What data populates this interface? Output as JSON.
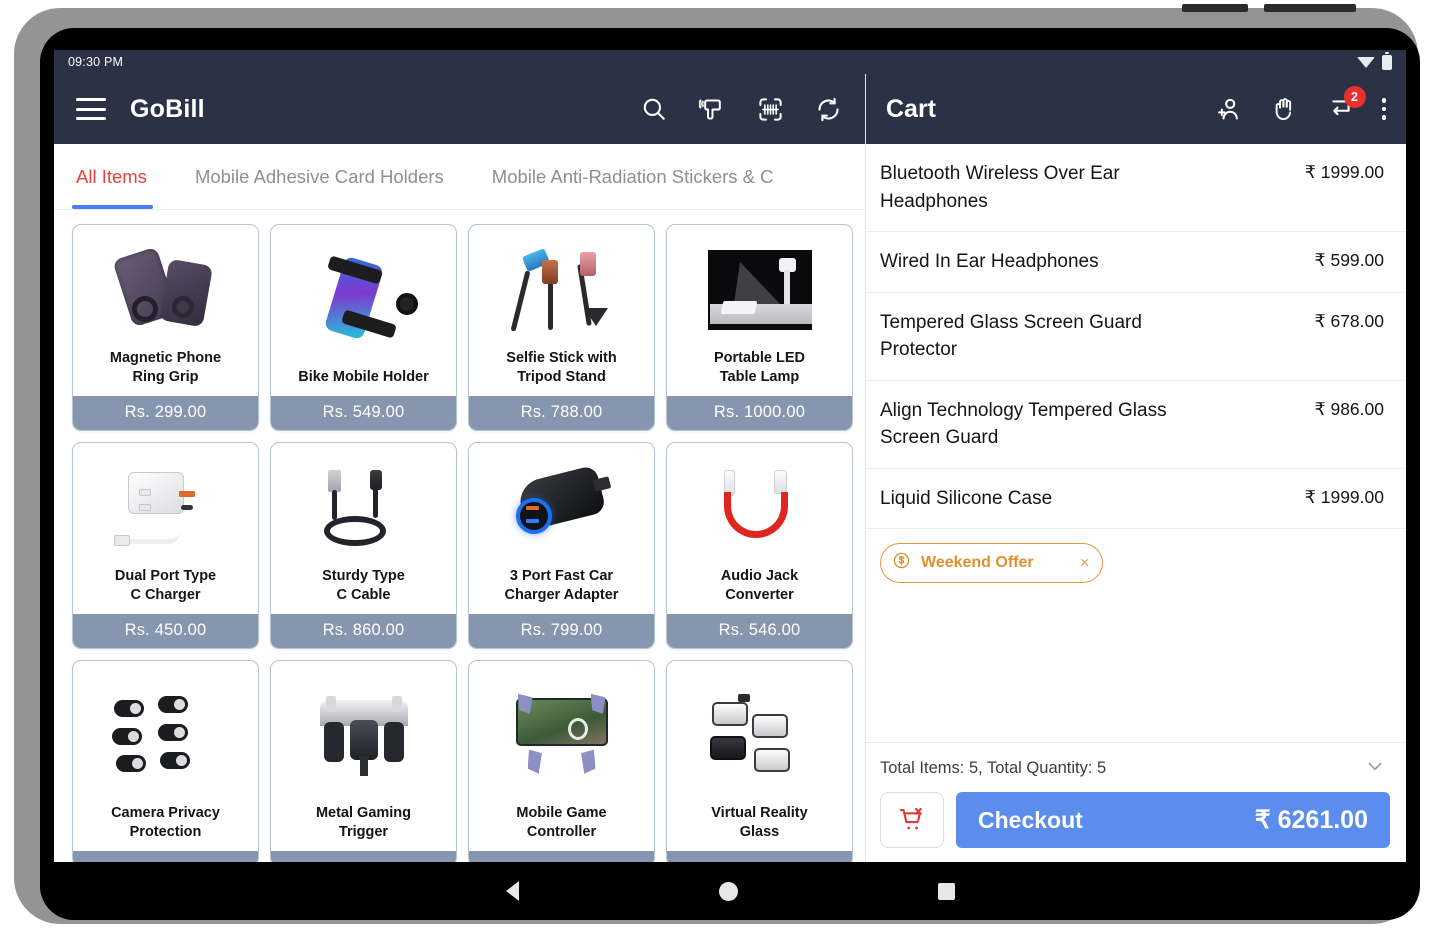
{
  "status_bar": {
    "time": "09:30 PM",
    "wifi_icon": "wifi-icon",
    "battery_icon": "battery-icon"
  },
  "app_bar": {
    "menu_icon": "hamburger-menu-icon",
    "title": "GoBill",
    "actions": [
      {
        "icon": "search-icon"
      },
      {
        "icon": "barcode-scanner-gun-icon"
      },
      {
        "icon": "barcode-scan-icon"
      },
      {
        "icon": "refresh-sync-icon"
      }
    ]
  },
  "tabs": [
    {
      "label": "All Items",
      "active": true
    },
    {
      "label": "Mobile Adhesive Card Holders",
      "active": false
    },
    {
      "label": "Mobile Anti-Radiation Stickers & C",
      "active": false
    }
  ],
  "products": [
    {
      "name": "Magnetic Phone\nRing Grip",
      "price": "Rs. 299.00",
      "thumb": "t-ring"
    },
    {
      "name": "Bike Mobile Holder",
      "price": "Rs. 549.00",
      "thumb": "t-bike"
    },
    {
      "name": "Selfie Stick with\nTripod Stand",
      "price": "Rs. 788.00",
      "thumb": "t-selfie"
    },
    {
      "name": "Portable LED\nTable Lamp",
      "price": "Rs. 1000.00",
      "thumb": "t-lamp"
    },
    {
      "name": "Dual Port Type\nC Charger",
      "price": "Rs. 450.00",
      "thumb": "t-charger"
    },
    {
      "name": "Sturdy Type\nC Cable",
      "price": "Rs. 860.00",
      "thumb": "t-cable"
    },
    {
      "name": "3 Port Fast Car\nCharger Adapter",
      "price": "Rs. 799.00",
      "thumb": "t-car"
    },
    {
      "name": "Audio Jack\nConverter",
      "price": "Rs. 546.00",
      "thumb": "t-jack"
    },
    {
      "name": "Camera Privacy\nProtection",
      "price": "",
      "thumb": "t-priv"
    },
    {
      "name": "Metal Gaming\nTrigger",
      "price": "",
      "thumb": "t-trig"
    },
    {
      "name": "Mobile Game\nController",
      "price": "",
      "thumb": "t-ctrl"
    },
    {
      "name": "Virtual Reality\nGlass",
      "price": "",
      "thumb": "t-vr"
    }
  ],
  "cart": {
    "title": "Cart",
    "actions": [
      {
        "icon": "add-customer-icon"
      },
      {
        "icon": "hold-hand-icon"
      },
      {
        "icon": "hold-return-icon",
        "badge": "2"
      },
      {
        "icon": "overflow-menu-icon"
      }
    ],
    "items": [
      {
        "name": "Bluetooth Wireless Over Ear Headphones",
        "price": "₹ 1999.00"
      },
      {
        "name": "Wired In Ear Headphones",
        "price": "₹ 599.00"
      },
      {
        "name": "Tempered Glass Screen Guard Protector",
        "price": "₹ 678.00"
      },
      {
        "name": "Align Technology Tempered Glass Screen Guard",
        "price": "₹ 986.00"
      },
      {
        "name": "Liquid Silicone Case",
        "price": "₹ 1999.00"
      }
    ],
    "offer": {
      "label": "Weekend Offer",
      "icon": "discount-coin-icon",
      "close": "×"
    },
    "footer": {
      "totals": "Total Items: 5, Total Quantity: 5",
      "chevron_icon": "chevron-down-icon",
      "clear_cart_icon": "remove-cart-icon",
      "checkout_label": "Checkout",
      "checkout_amount": "₹ 6261.00"
    }
  },
  "nav_bar": {
    "back": "back-triangle-icon",
    "home": "home-circle-icon",
    "recents": "recents-square-icon"
  },
  "colors": {
    "app_bar": "#2b3245",
    "accent_red": "#e8423a",
    "tab_underline": "#4a7df0",
    "price_bar": "#8796af",
    "checkout_blue": "#5b8def",
    "offer_orange": "#e0912f",
    "badge_red": "#e8312b"
  }
}
